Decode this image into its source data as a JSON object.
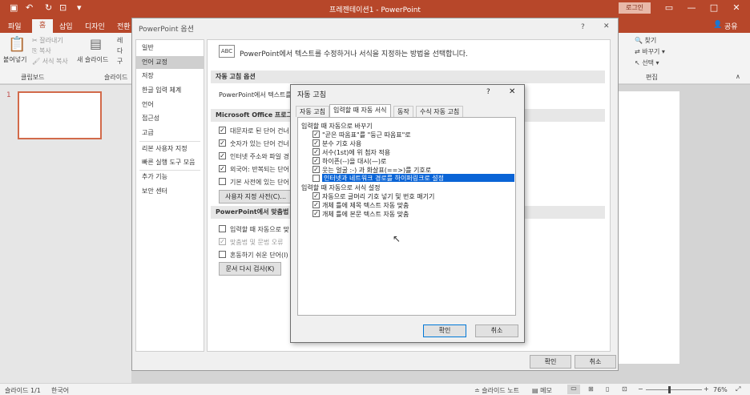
{
  "app": {
    "title": "프레젠테이션1  -  PowerPoint",
    "login": "로그인",
    "share": "공유"
  },
  "tabs": [
    "파일",
    "홈",
    "삽입",
    "디자인",
    "전환"
  ],
  "ribbon": {
    "paste": "붙여넣기",
    "cut": "잘라내기",
    "copy": "복사",
    "format_copy": "서식 복사",
    "clipboard_group": "클립보드",
    "new_slide": "새 슬라이드",
    "slides_group": "슬라이드",
    "layout_stub": "레",
    "reset_stub": "다",
    "section_stub": "구",
    "find": "찾기",
    "replace": "바꾸기",
    "select": "선택",
    "edit_group": "편집"
  },
  "slide_panel": {
    "slide_number": "1"
  },
  "options": {
    "title": "PowerPoint 옵션",
    "nav": [
      "일반",
      "언어 교정",
      "저장",
      "한글 입력 체계",
      "언어",
      "접근성",
      "고급",
      "리본 사용자 지정",
      "빠른 실행 도구 모음",
      "추가 기능",
      "보안 센터"
    ],
    "header": "PowerPoint에서 텍스트를 수정하거나 서식을 지정하는 방법을 선택합니다.",
    "section1": "자동 고침 옵션",
    "section1_text": "PowerPoint에서 텍스트를",
    "section2": "Microsoft Office 프로그램",
    "section2_items": [
      "대문자로 된 단어 건너",
      "숫자가 있는 단어 건너",
      "인터넷 주소와 파일 경",
      "외국어: 반복되는 단어",
      "기본 사전에 있는 단어"
    ],
    "custom_dict_button": "사용자 지정 사전(C)...",
    "section3": "PowerPoint에서 맞춤법 검",
    "section3_items": [
      "입력할 때 자동으로 맞",
      "맞춤법 및 문법 오류",
      "혼동하기 쉬운 단어(I)"
    ],
    "recheck_button": "문서 다시 검사(K)",
    "ok": "확인",
    "cancel": "취소"
  },
  "autocorrect": {
    "title": "자동 고침",
    "help": "?",
    "tabs": [
      "자동 고침",
      "입력할 때 자동 서식",
      "동작",
      "수식 자동 고침"
    ],
    "group1": "입력할 때 자동으로 바꾸기",
    "group1_items": [
      {
        "label": "\"곧은 따옴표\"를 \"둥근 따옴표\"로",
        "checked": true
      },
      {
        "label": "분수 기호 사용",
        "checked": true
      },
      {
        "label": "서수(1st)에 위 첨자 적용",
        "checked": true
      },
      {
        "label": "하이픈(--)을 대시(—)로",
        "checked": true
      },
      {
        "label": "웃는 얼굴 :-) 과 화살표(==>)를 기호로",
        "checked": true
      },
      {
        "label": "인터넷과 네트워크 경로를 하이퍼링크로 설정",
        "checked": false
      }
    ],
    "group2": "입력할 때 자동으로 서식 설정",
    "group2_items": [
      {
        "label": "자동으로 글머리 기호 넣기 및 번호 매기기",
        "checked": true
      },
      {
        "label": "개체 틀에 제목 텍스트 자동 맞춤",
        "checked": true
      },
      {
        "label": "개체 틀에 본문 텍스트 자동 맞춤",
        "checked": true
      }
    ],
    "ok": "확인",
    "cancel": "취소"
  },
  "status": {
    "slide": "슬라이드 1/1",
    "lang": "한국어",
    "notes": "슬라이드 노트",
    "memo": "메모",
    "zoom": "76%"
  }
}
